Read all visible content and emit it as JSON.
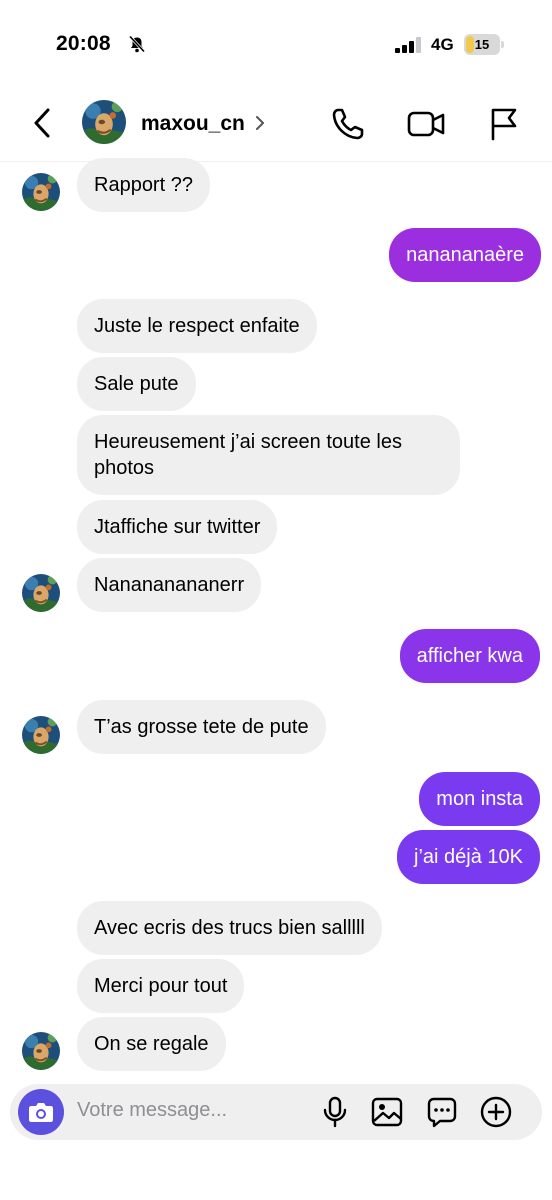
{
  "status_bar": {
    "time": "20:08",
    "network": "4G",
    "battery_level": "15",
    "icons": [
      "bell-slash-icon",
      "signal-icon",
      "battery-icon"
    ]
  },
  "header": {
    "username": "maxou_cn",
    "icons": [
      "back-chevron-icon",
      "avatar",
      "chevron-right-icon",
      "phone-icon",
      "video-camera-icon",
      "flag-icon"
    ]
  },
  "messages": [
    {
      "direction": "incoming",
      "text": "Rapport ??"
    },
    {
      "direction": "outgoing",
      "text": "nanananaère"
    },
    {
      "direction": "incoming",
      "text": "Juste le respect enfaite"
    },
    {
      "direction": "incoming",
      "text": "Sale pute"
    },
    {
      "direction": "incoming",
      "text": "Heureusement j’ai screen toute les photos"
    },
    {
      "direction": "incoming",
      "text": "Jtaffiche sur twitter"
    },
    {
      "direction": "incoming",
      "text": "Nanananananerr"
    },
    {
      "direction": "outgoing",
      "text": "afficher kwa"
    },
    {
      "direction": "incoming",
      "text": "T’as grosse tete de pute"
    },
    {
      "direction": "outgoing",
      "text": "mon insta"
    },
    {
      "direction": "outgoing",
      "text": "j’ai déjà 10K"
    },
    {
      "direction": "incoming",
      "text": "Avec ecris des trucs bien salllll"
    },
    {
      "direction": "incoming",
      "text": "Merci pour tout"
    },
    {
      "direction": "incoming",
      "text": "On se regale"
    }
  ],
  "composer": {
    "placeholder": "Votre message...",
    "icons": [
      "camera-icon",
      "microphone-icon",
      "image-icon",
      "sticker-icon",
      "plus-circle-icon"
    ]
  },
  "colors": {
    "incoming_bubble": "#efeff0",
    "outgoing_purple": "#9b2fe0",
    "outgoing_violet": "#7a3af0",
    "camera_button": "#5b51de",
    "placeholder": "#8e8e93"
  }
}
